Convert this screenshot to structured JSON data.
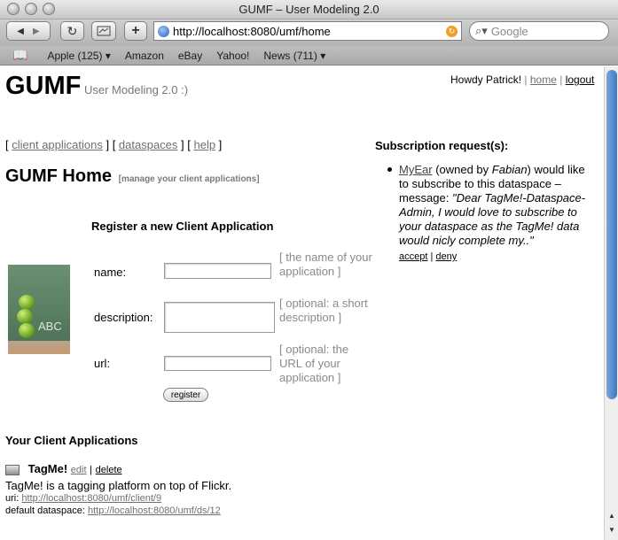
{
  "window": {
    "title": "GUMF – User Modeling 2.0"
  },
  "toolbar": {
    "back_icon": "back-arrow-icon",
    "forward_icon": "forward-arrow-icon",
    "reload_icon": "reload-icon",
    "url": "http://localhost:8080/umf/home",
    "search_placeholder": "Google",
    "add_label": "+"
  },
  "bookmarks": [
    "Apple (125)",
    "Amazon",
    "eBay",
    "Yahoo!",
    "News (711)"
  ],
  "header": {
    "logo": "GUMF",
    "tagline": "User Modeling 2.0 :)",
    "greeting": "Howdy Patrick!",
    "home_link": "home",
    "logout_link": "logout"
  },
  "nav": {
    "client_applications": "client applications",
    "dataspaces": "dataspaces",
    "help": "help"
  },
  "main": {
    "title": "GUMF Home",
    "manage_link": "[manage your client applications]"
  },
  "register": {
    "title": "Register a new Client Application",
    "name_label": "name:",
    "name_hint": "[ the name of your application ]",
    "description_label": "description:",
    "description_hint": "[ optional: a short description ]",
    "url_label": "url:",
    "url_hint": "[ optional: the URL of your application ]",
    "button": "register",
    "name_value": "",
    "description_value": "",
    "url_value": ""
  },
  "client_apps": {
    "title": "Your Client Applications",
    "items": [
      {
        "name": "TagMe!",
        "edit": "edit",
        "delete": "delete",
        "description": "TagMe! is a tagging platform on top of Flickr.",
        "uri_label": "uri:",
        "uri": "http://localhost:8080/umf/client/9",
        "dataspace_label": "default dataspace:",
        "dataspace": "http://localhost:8080/umf/ds/12"
      }
    ]
  },
  "subscriptions": {
    "title": "Subscription request(s):",
    "requests": [
      {
        "app": "MyEar",
        "owned_prefix": "(owned by",
        "owner": "Fabian",
        "text": ") would like to subscribe to this dataspace – message:",
        "message": "\"Dear TagMe!-Dataspace-Admin, I would love to subscribe to your dataspace as the TagMe! data would nicly complete my..\"",
        "accept": "accept",
        "deny": "deny"
      }
    ]
  },
  "image": {
    "chalkboard_text": "ABC"
  }
}
